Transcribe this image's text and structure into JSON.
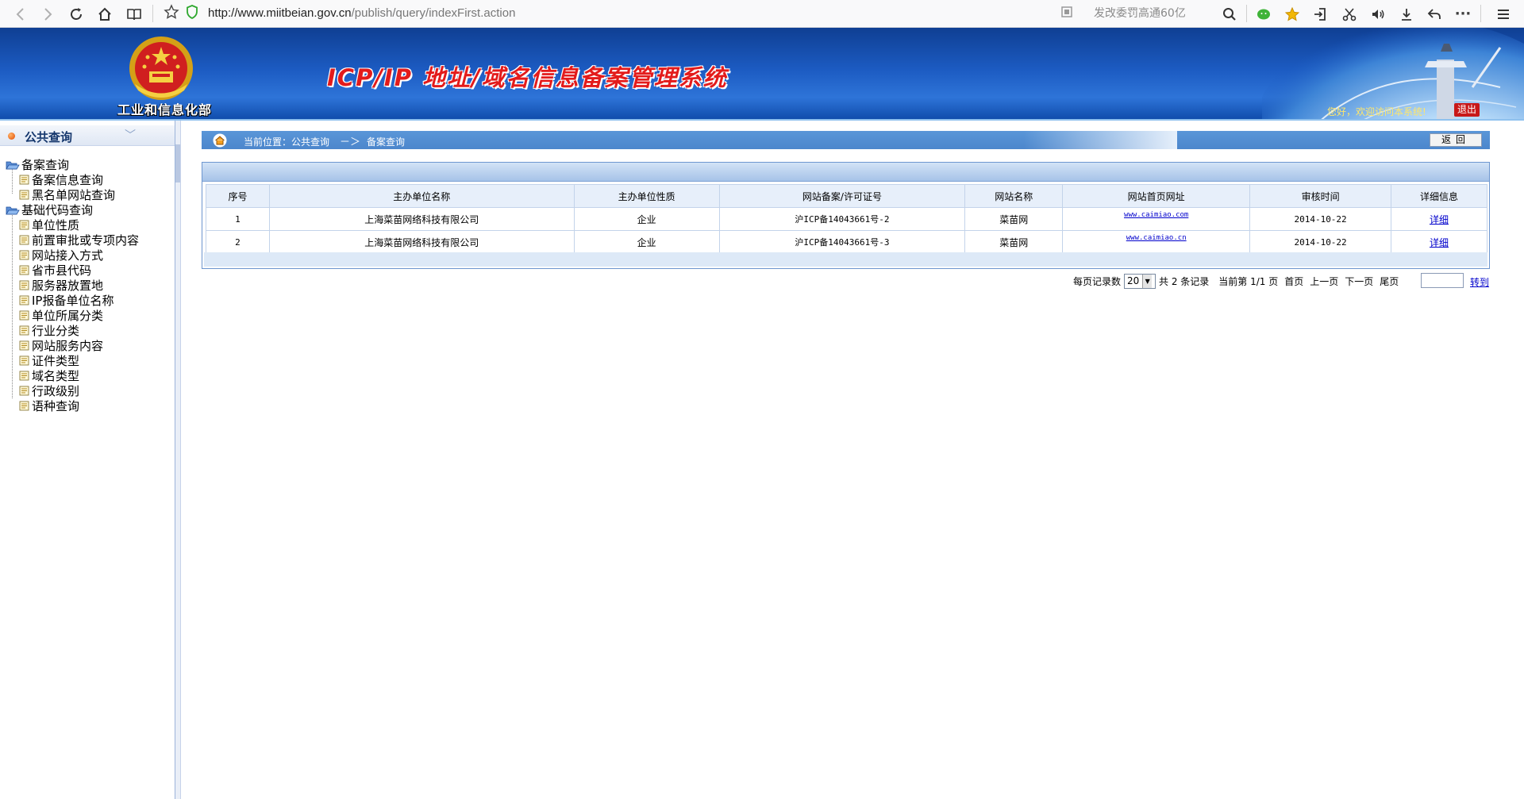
{
  "browser": {
    "url_host": "http://www.miitbeian.gov.cn",
    "url_path": "/publish/query/indexFirst.action",
    "search_placeholder": "发改委罚高通60亿"
  },
  "header": {
    "ministry_name": "工业和信息化部",
    "system_title": "ICP/IP 地址/域名信息备案管理系统",
    "welcome": "您好，欢迎访问本系统!",
    "logout_label": "退出"
  },
  "sidebar": {
    "title": "公共查询",
    "groups": [
      {
        "label": "备案查询",
        "items": [
          "备案信息查询",
          "黑名单网站查询"
        ]
      },
      {
        "label": "基础代码查询",
        "items": [
          "单位性质",
          "前置审批或专项内容",
          "网站接入方式",
          "省市县代码",
          "服务器放置地",
          "IP报备单位名称",
          "单位所属分类",
          "行业分类",
          "网站服务内容",
          "证件类型",
          "域名类型",
          "行政级别",
          "语种查询"
        ]
      }
    ]
  },
  "breadcrumb": {
    "label": "当前位置：公共查询",
    "arrow": "－＞",
    "current": "备案查询",
    "back_label": "返回"
  },
  "table": {
    "headers": [
      "序号",
      "主办单位名称",
      "主办单位性质",
      "网站备案/许可证号",
      "网站名称",
      "网站首页网址",
      "审核时间",
      "详细信息"
    ],
    "rows": [
      [
        "1",
        "上海菜苗网络科技有限公司",
        "企业",
        "沪ICP备14043661号-2",
        "菜苗网",
        "www.caimiao.com",
        "2014-10-22",
        "详细"
      ],
      [
        "2",
        "上海菜苗网络科技有限公司",
        "企业",
        "沪ICP备14043661号-3",
        "菜苗网",
        "www.caimiao.cn",
        "2014-10-22",
        "详细"
      ]
    ]
  },
  "pager": {
    "page_size_label": "每页记录数",
    "page_size": "20",
    "total": "共 2 条记录",
    "current_page": "当前第 1/1 页",
    "first": "首页",
    "prev": "上一页",
    "next": "下一页",
    "last": "尾页",
    "goto": "转到"
  }
}
